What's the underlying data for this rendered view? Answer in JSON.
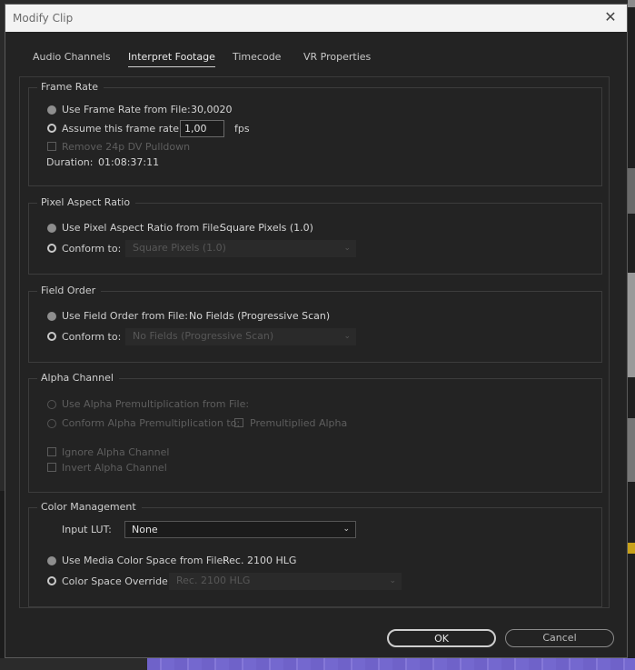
{
  "window": {
    "title": "Modify Clip",
    "close_icon": "close-icon"
  },
  "tabs": [
    {
      "label": "Audio Channels",
      "active": false
    },
    {
      "label": "Interpret Footage",
      "active": true
    },
    {
      "label": "Timecode",
      "active": false
    },
    {
      "label": "VR Properties",
      "active": false
    }
  ],
  "frame_rate": {
    "group_label": "Frame Rate",
    "use_file_label": "Use Frame Rate from File:",
    "use_file_value": "30,0020",
    "assume_label": "Assume this frame rate:",
    "assume_value": "1,00",
    "fps_label": "fps",
    "pulldown_label": "Remove 24p DV Pulldown",
    "duration_label": "Duration:",
    "duration_value": "01:08:37:11"
  },
  "pixel_aspect": {
    "group_label": "Pixel Aspect Ratio",
    "use_file_label": "Use Pixel Aspect Ratio from File:",
    "use_file_value": "Square Pixels (1.0)",
    "conform_label": "Conform to:",
    "conform_value": "Square Pixels (1.0)"
  },
  "field_order": {
    "group_label": "Field Order",
    "use_file_label": "Use Field Order from File:",
    "use_file_value": "No Fields (Progressive Scan)",
    "conform_label": "Conform to:",
    "conform_value": "No Fields (Progressive Scan)"
  },
  "alpha_channel": {
    "group_label": "Alpha Channel",
    "use_premult_label": "Use Alpha Premultiplication from File:",
    "conform_premult_label": "Conform Alpha Premultiplication to:",
    "premultiplied_label": "Premultiplied Alpha",
    "ignore_label": "Ignore Alpha Channel",
    "invert_label": "Invert Alpha Channel"
  },
  "color_management": {
    "group_label": "Color Management",
    "input_lut_label": "Input LUT:",
    "input_lut_value": "None",
    "use_media_label": "Use Media Color Space from File:",
    "use_media_value": "Rec. 2100 HLG",
    "override_label": "Color Space Override:",
    "override_value": "Rec. 2100 HLG"
  },
  "buttons": {
    "ok_label": "OK",
    "cancel_label": "Cancel"
  },
  "colors": {
    "dialog_bg": "#232323",
    "titlebar_bg": "#f3f3f3",
    "timeline_clip": "#6f62c9"
  }
}
